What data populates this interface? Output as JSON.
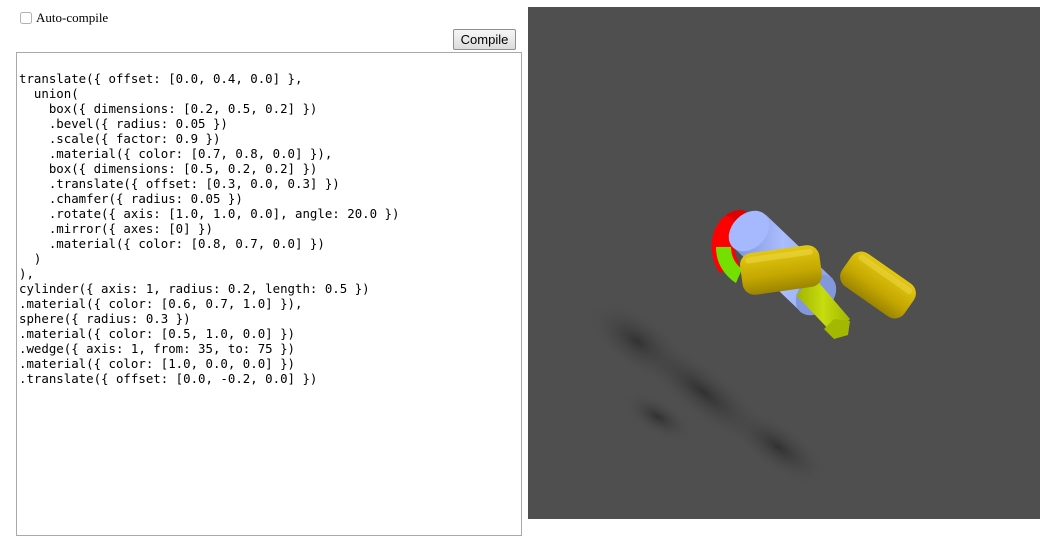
{
  "autocompile": {
    "label": "Auto-compile",
    "checked": false
  },
  "toolbar": {
    "compile_label": "Compile"
  },
  "editor": {
    "code": "translate({ offset: [0.0, 0.4, 0.0] },\n  union(\n    box({ dimensions: [0.2, 0.5, 0.2] })\n    .bevel({ radius: 0.05 })\n    .scale({ factor: 0.9 })\n    .material({ color: [0.7, 0.8, 0.0] }),\n    box({ dimensions: [0.5, 0.2, 0.2] })\n    .translate({ offset: [0.3, 0.0, 0.3] })\n    .chamfer({ radius: 0.05 })\n    .rotate({ axis: [1.0, 1.0, 0.0], angle: 20.0 })\n    .mirror({ axes: [0] })\n    .material({ color: [0.8, 0.7, 0.0] })\n  )\n),\ncylinder({ axis: 1, radius: 0.2, length: 0.5 })\n.material({ color: [0.6, 0.7, 1.0] }),\nsphere({ radius: 0.3 })\n.material({ color: [0.5, 1.0, 0.0] })\n.wedge({ axis: 1, from: 35, to: 75 })\n.material({ color: [1.0, 0.0, 0.0] })\n.translate({ offset: [0.0, -0.2, 0.0] })"
  },
  "viewport": {
    "background": "#4f4f4f",
    "colors": {
      "cylinder": "#99b3ff",
      "sphere_green": "#80ff00",
      "wedge_red": "#ff0000",
      "box_lime": "#b3cc00",
      "box_gold": "#ccb300"
    }
  }
}
